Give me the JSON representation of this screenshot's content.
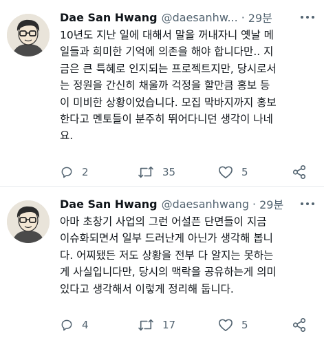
{
  "tweets": [
    {
      "name": "Dae San Hwang",
      "handle": "@daesanhw...",
      "dot": "·",
      "time": "29분",
      "text": "10년도 지난 일에 대해서 말을 꺼내자니 옛날 메\n일들과 희미한 기억에 의존을 해야 합니다만.. 지\n금은 큰 특혜로 인지되는 프로젝트지만, 당시로서\n는 정원을 간신히 채울까 걱정을 할만큼 홍보 등\n이 미비한 상황이었습니다. 모집 막바지까지 홍보\n한다고 멘토들이 분주히 뛰어다니던 생각이 나네\n요.",
      "replies": "2",
      "retweets": "35",
      "likes": "5"
    },
    {
      "name": "Dae San Hwang",
      "handle": "@daesanhwang",
      "dot": "·",
      "time": "29분",
      "text": "아마 초창기 사업의 그런 어설픈 단면들이 지금\n이슈화되면서 일부 드러난게 아닌가 생각해 봅니\n다. 어찌됐든 저도 상황을 전부 다 알지는 못하는\n게 사실입니다만, 당시의 맥락을 공유하는게 의미\n있다고 생각해서 이렇게 정리해 둡니다.",
      "replies": "4",
      "retweets": "17",
      "likes": "5"
    }
  ],
  "icons": {
    "reply": "reply-icon",
    "retweet": "retweet-icon",
    "like": "heart-icon",
    "share": "share-icon",
    "more": "more-icon",
    "avatar": "avatar-cartoon"
  },
  "colors": {
    "text": "#0f1419",
    "secondary": "#536471",
    "divider": "#e8ecef"
  }
}
